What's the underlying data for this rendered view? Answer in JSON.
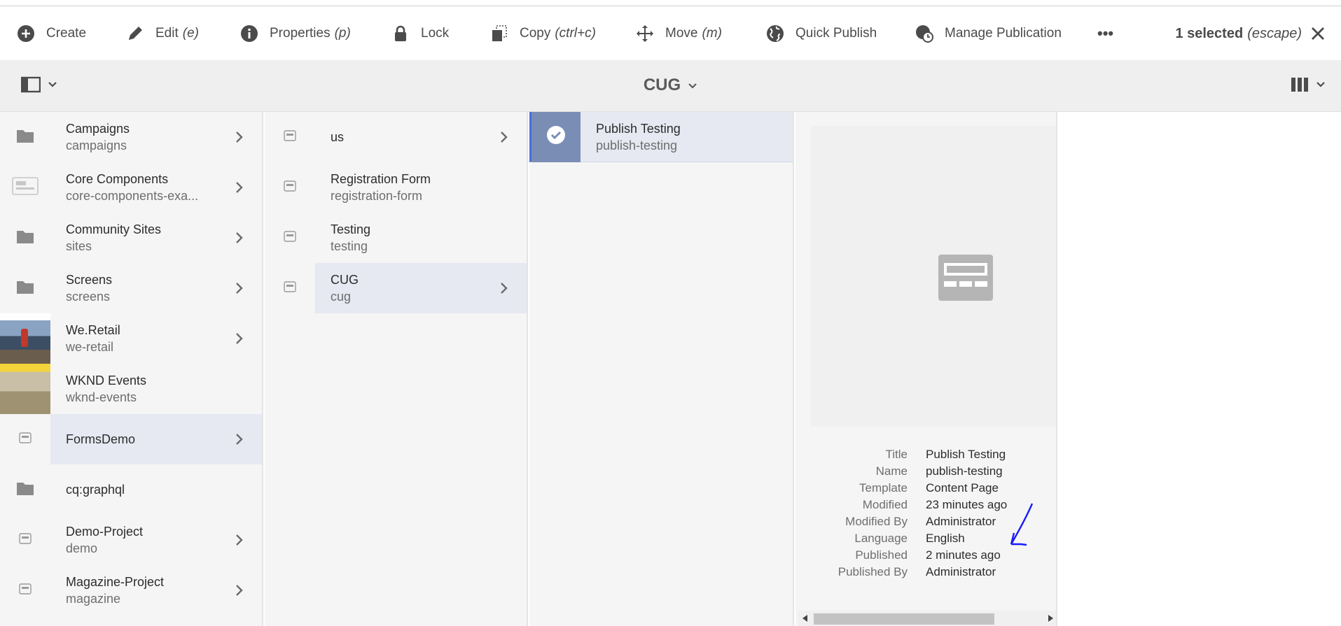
{
  "actionbar": {
    "create": "Create",
    "edit": "Edit",
    "edit_hint": "(e)",
    "properties": "Properties",
    "properties_hint": "(p)",
    "lock": "Lock",
    "copy": "Copy",
    "copy_hint": "(ctrl+c)",
    "move": "Move",
    "move_hint": "(m)",
    "quick_publish": "Quick Publish",
    "manage_publication": "Manage Publication",
    "more": "•••",
    "selected": "1 selected",
    "selected_hint": "(escape)"
  },
  "header": {
    "title": "CUG"
  },
  "column1": [
    {
      "title": "Campaigns",
      "name": "campaigns",
      "thumb": "folder-icon",
      "has_children": true
    },
    {
      "title": "Core Components",
      "name": "core-components-exa...",
      "thumb": "template-icon",
      "has_children": true
    },
    {
      "title": "Community Sites",
      "name": "sites",
      "thumb": "folder-icon",
      "has_children": true
    },
    {
      "title": "Screens",
      "name": "screens",
      "thumb": "folder-icon",
      "has_children": true
    },
    {
      "title": "We.Retail",
      "name": "we-retail",
      "thumb": "we-retail-image",
      "has_children": true
    },
    {
      "title": "WKND Events",
      "name": "wknd-events",
      "thumb": "wknd-image",
      "has_children": false
    },
    {
      "title": "FormsDemo",
      "name": "",
      "thumb": "page-icon",
      "has_children": true,
      "active": true
    },
    {
      "title": "cq:graphql",
      "name": "",
      "thumb": "folder-icon",
      "has_children": false
    },
    {
      "title": "Demo-Project",
      "name": "demo",
      "thumb": "page-icon",
      "has_children": true
    },
    {
      "title": "Magazine-Project",
      "name": "magazine",
      "thumb": "page-icon",
      "has_children": true
    }
  ],
  "column2": [
    {
      "title": "us",
      "name": "",
      "has_children": true
    },
    {
      "title": "Registration Form",
      "name": "registration-form",
      "has_children": false
    },
    {
      "title": "Testing",
      "name": "testing",
      "has_children": false
    },
    {
      "title": "CUG",
      "name": "cug",
      "has_children": true,
      "active": true
    }
  ],
  "column3": [
    {
      "title": "Publish Testing",
      "name": "publish-testing",
      "checked": true
    }
  ],
  "properties": [
    {
      "key": "Title",
      "value": "Publish Testing"
    },
    {
      "key": "Name",
      "value": "publish-testing"
    },
    {
      "key": "Template",
      "value": "Content Page"
    },
    {
      "key": "Modified",
      "value": "23 minutes ago"
    },
    {
      "key": "Modified By",
      "value": "Administrator"
    },
    {
      "key": "Language",
      "value": "English"
    },
    {
      "key": "Published",
      "value": "2 minutes ago"
    },
    {
      "key": "Published By",
      "value": "Administrator"
    }
  ],
  "colors": {
    "accent": "#4a6fd8",
    "selected_bg": "#e6e9f2",
    "annotation": "#1a1aff"
  }
}
